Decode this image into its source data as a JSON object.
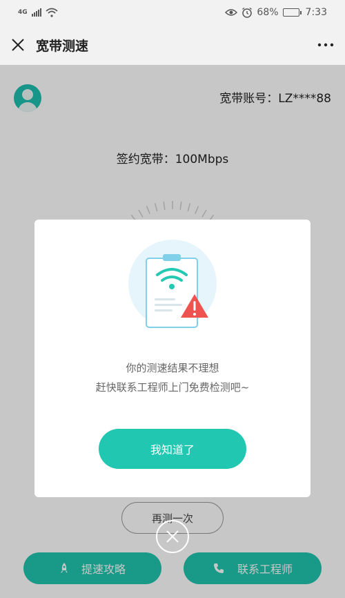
{
  "status_bar": {
    "network": "4G",
    "battery_percent": "68%",
    "battery_level": 0.68,
    "time": "7:33",
    "icons": [
      "signal-icon",
      "wifi-icon",
      "eye-icon",
      "alarm-icon",
      "battery-icon"
    ]
  },
  "header": {
    "title": "宽带测速",
    "close_icon": "close-icon",
    "more_icon": "more-icon"
  },
  "main": {
    "account_label": "宽带账号：LZ****88",
    "contract_label": "签约宽带：100Mbps",
    "retest_label": "再测一次",
    "tips_label": "提速攻略",
    "contact_label": "联系工程师"
  },
  "dialog": {
    "message_line1": "你的测速结果不理想",
    "message_line2": "赶快联系工程师上门免费检测吧~",
    "ok_label": "我知道了"
  },
  "colors": {
    "accent": "#22c7b2",
    "warning": "#e94b4b",
    "overlay": "rgba(0,0,0,0.22)"
  }
}
